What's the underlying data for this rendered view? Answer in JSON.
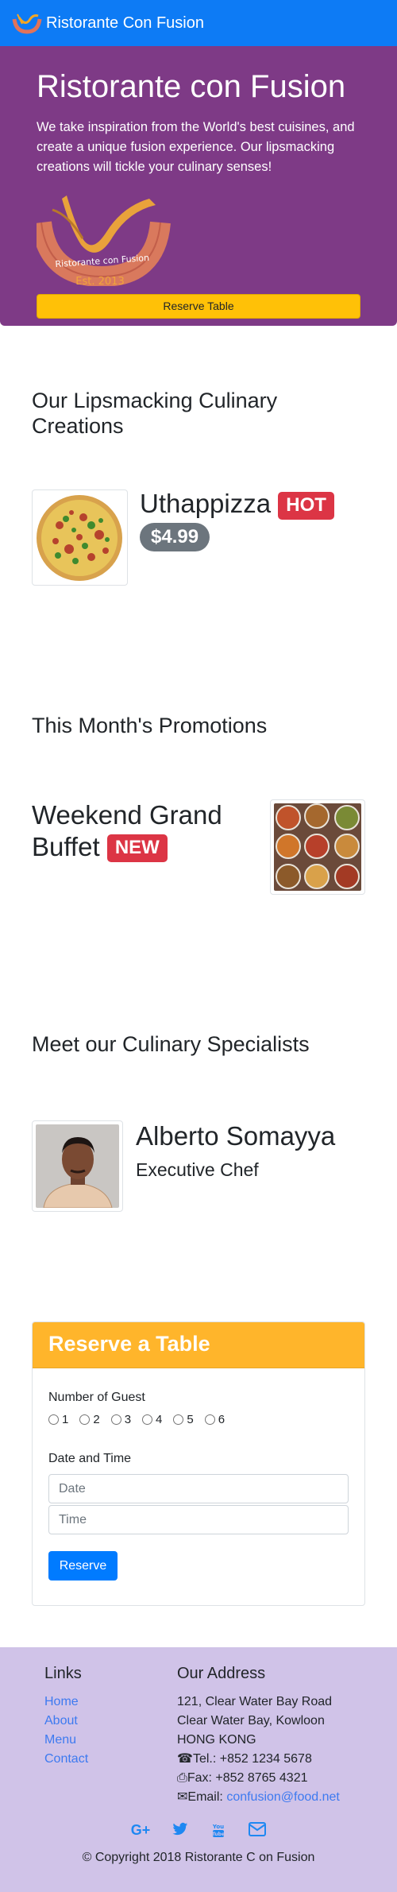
{
  "navbar": {
    "brand": "Ristorante Con Fusion",
    "logo_icon": "restaurant-logo-icon"
  },
  "jumbotron": {
    "title": "Ristorante con Fusion",
    "description": "We take inspiration from the World's best cuisines, and create a unique fusion experience. Our lipsmacking creations will tickle your culinary senses!",
    "logo_text": "Ristorante con Fusion",
    "logo_est": "Est. 2013",
    "reserve_button": "Reserve Table"
  },
  "dishes": {
    "title": "Our Lipsmacking Culinary Creations",
    "name": "Uthappizza",
    "badge": "HOT",
    "price": "$4.99"
  },
  "promotions": {
    "title": "This Month's Promotions",
    "name_line1": "Weekend Grand",
    "name_line2": "Buffet",
    "badge": "NEW"
  },
  "leaders": {
    "title": "Meet our Culinary Specialists",
    "name": "Alberto Somayya",
    "designation": "Executive Chef"
  },
  "reserve": {
    "title": "Reserve a Table",
    "guests_label": "Number of Guest",
    "guests": [
      "1",
      "2",
      "3",
      "4",
      "5",
      "6"
    ],
    "date_time_label": "Date and Time",
    "date_placeholder": "Date",
    "time_placeholder": "Time",
    "submit": "Reserve"
  },
  "footer": {
    "links_title": "Links",
    "links": [
      "Home",
      "About",
      "Menu",
      "Contact"
    ],
    "address_title": "Our Address",
    "address_lines": [
      "121, Clear Water Bay Road",
      "Clear Water Bay, Kowloon",
      "HONG KONG"
    ],
    "tel": "Tel.: +852 1234 5678",
    "fax": "Fax: +852 8765 4321",
    "email_label": "Email: ",
    "email": "confusion@food.net",
    "social_icons": [
      "google-plus-icon",
      "twitter-icon",
      "youtube-icon",
      "mail-icon"
    ],
    "copyright": "© Copyright 2018 Ristorante C on Fusion"
  },
  "colors": {
    "navbar": "#0d7bf5",
    "jumbotron": "#7e3a86",
    "warning": "#ffc107",
    "danger": "#dc3545",
    "footer": "#d0c3e8"
  }
}
